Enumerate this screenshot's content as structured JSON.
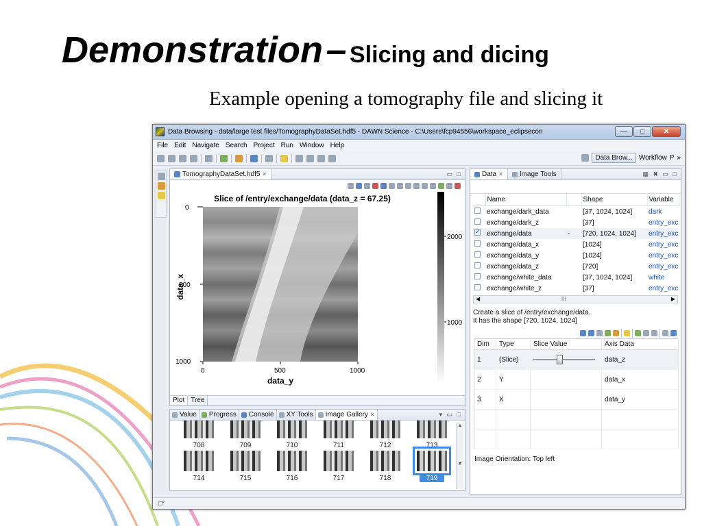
{
  "slide": {
    "title": "Demonstration",
    "title_dash": "–",
    "title_small": "Slicing and dicing",
    "subtitle": "Example opening a tomography file and slicing it"
  },
  "window": {
    "title": "Data Browsing - data/large test files/TomographyDataSet.hdf5 - DAWN Science - C:\\Users\\fcp94556\\workspace_eclipsecon",
    "menu": [
      "File",
      "Edit",
      "Navigate",
      "Search",
      "Project",
      "Run",
      "Window",
      "Help"
    ],
    "perspective_active": "Data Brow...",
    "perspective_other": "Workflow",
    "perspective_more": "P",
    "perspective_overflow": "»"
  },
  "editor": {
    "tab_label": "TomographyDataSet.hdf5",
    "plot_title": "Slice of /entry/exchange/data (data_z = 67.25)",
    "ylabel": "data_x",
    "xlabel": "data_y",
    "xticks": [
      "0",
      "500",
      "1000"
    ],
    "yticks": [
      "0",
      "500",
      "1000"
    ],
    "colorbar_ticks": [
      "2000",
      "1000"
    ],
    "bottom_tabs": [
      "Plot",
      "Tree"
    ]
  },
  "gallery": {
    "tabs": [
      "Value",
      "Progress",
      "Console",
      "XY Tools",
      "Image Gallery"
    ],
    "row1": [
      "708",
      "709",
      "710",
      "711",
      "712",
      "713"
    ],
    "row2": [
      "714",
      "715",
      "716",
      "717",
      "718",
      "719"
    ],
    "selected": "719"
  },
  "data_panel": {
    "tabs": [
      "Data",
      "Image Tools"
    ],
    "columns": [
      "Name",
      "",
      "Shape",
      "Variable"
    ],
    "rows": [
      {
        "name": "exchange/dark_data",
        "mark": "",
        "shape": "[37, 1024, 1024]",
        "variable": "dark",
        "checked": false
      },
      {
        "name": "exchange/dark_z",
        "mark": "",
        "shape": "[37]",
        "variable": "entry_exc",
        "checked": false
      },
      {
        "name": "exchange/data",
        "mark": "-",
        "shape": "[720, 1024, 1024]",
        "variable": "entry_exc",
        "checked": true
      },
      {
        "name": "exchange/data_x",
        "mark": "",
        "shape": "[1024]",
        "variable": "entry_exc",
        "checked": false
      },
      {
        "name": "exchange/data_y",
        "mark": "",
        "shape": "[1024]",
        "variable": "entry_exc",
        "checked": false
      },
      {
        "name": "exchange/data_z",
        "mark": "",
        "shape": "[720]",
        "variable": "entry_exc",
        "checked": false
      },
      {
        "name": "exchange/white_data",
        "mark": "",
        "shape": "[37, 1024, 1024]",
        "variable": "white",
        "checked": false
      },
      {
        "name": "exchange/white_z",
        "mark": "",
        "shape": "[37]",
        "variable": "entry_exc",
        "checked": false
      }
    ],
    "scroll_mid": "III",
    "slice_desc_1": "Create a slice of /entry/exchange/data.",
    "slice_desc_2": "It has the shape [720, 1024, 1024]",
    "slice_columns": [
      "Dim",
      "Type",
      "Slice Value",
      "Axis Data"
    ],
    "slice_rows": [
      {
        "dim": "1",
        "type": "(Slice)",
        "axis": "data_z"
      },
      {
        "dim": "2",
        "type": "Y",
        "axis": "data_x"
      },
      {
        "dim": "3",
        "type": "X",
        "axis": "data_y"
      }
    ],
    "orientation": "Image Orientation: Top left"
  },
  "statusbar": {
    "icon": "□°"
  }
}
